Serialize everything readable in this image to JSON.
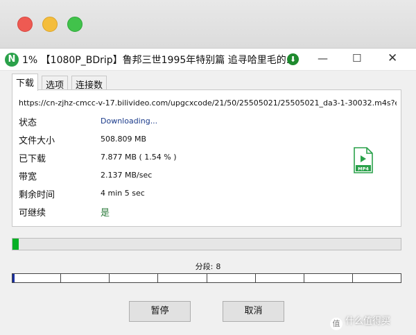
{
  "window": {
    "app_icon_letter": "N",
    "title": "1% 【1080P_BDrip】鲁邦三世1995年特别篇 追寻哈里毛的...",
    "download_badge_icon": "arrow-down-icon",
    "minimize_glyph": "—",
    "maximize_glyph": "☐",
    "close_glyph": "✕"
  },
  "tabs": [
    "下载",
    "选项",
    "连接数"
  ],
  "download": {
    "url": "https://cn-zjhz-cmcc-v-17.bilivideo.com/upgcxcode/21/50/25505021/25505021_da3-1-30032.m4s?e=i",
    "fields": [
      {
        "label": "状态",
        "value": "Downloading..."
      },
      {
        "label": "文件大小",
        "value": "508.809 MB"
      },
      {
        "label": "已下载",
        "value": "7.877 MB ( 1.54 % )"
      },
      {
        "label": "带宽",
        "value": "2.137 MB/sec"
      },
      {
        "label": "剩余时间",
        "value": "4 min  5 sec"
      },
      {
        "label": "可继续",
        "value": "是"
      }
    ],
    "file_type": "MP4",
    "progress_fraction": 0.0154
  },
  "segments": {
    "label": "分段:",
    "count": "8",
    "fills": [
      0.05,
      0,
      0,
      0,
      0,
      0,
      0,
      0
    ]
  },
  "buttons": {
    "pause": "暂停",
    "cancel": "取消"
  },
  "watermark": {
    "logo_char": "值",
    "text": "什么值得买"
  },
  "colors": {
    "progress_green": "#06b025",
    "segment_blue": "#1a2fa0",
    "app_icon_green": "#2aa14a"
  }
}
